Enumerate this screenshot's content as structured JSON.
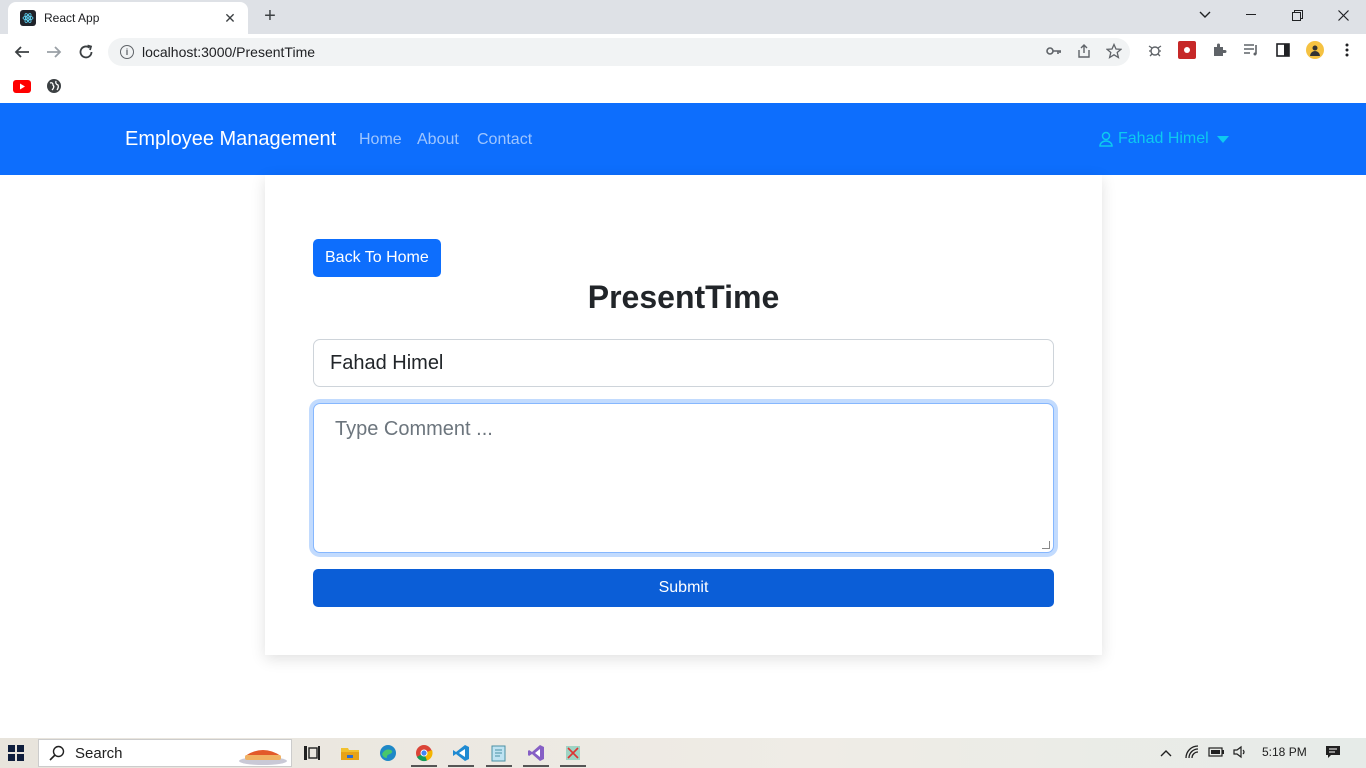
{
  "browser": {
    "tab_title": "React App",
    "url": "localhost:3000/PresentTime"
  },
  "navbar": {
    "brand": "Employee Management",
    "links": [
      "Home",
      "About",
      "Contact"
    ],
    "user_name": "Fahad Himel"
  },
  "form": {
    "back_button": "Back To Home",
    "title": "PresentTime",
    "name_value": "Fahad Himel",
    "comment_placeholder": "Type Comment ...",
    "submit_label": "Submit"
  },
  "taskbar": {
    "search_label": "Search",
    "time": "5:18 PM"
  },
  "colors": {
    "primary": "#0d6efd",
    "submit": "#0b5ed7",
    "user_accent": "#0dcaf0"
  }
}
